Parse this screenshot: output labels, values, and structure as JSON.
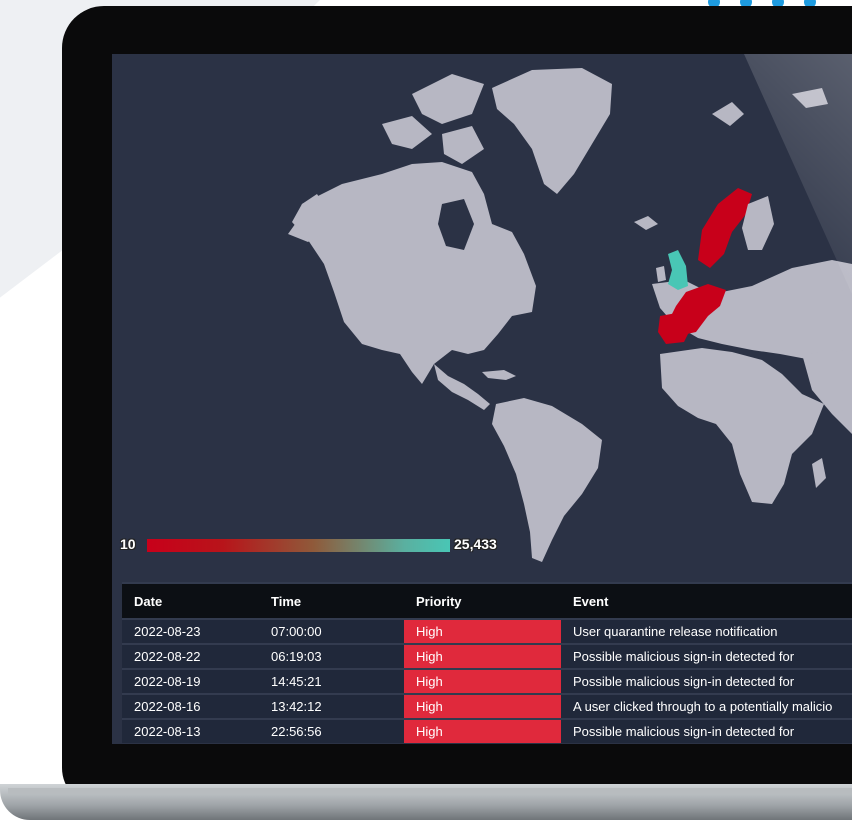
{
  "dashboard": {
    "scale": {
      "min_label": "10",
      "max_label": "25,433"
    },
    "colors": {
      "high_priority": "#e0293c",
      "country_high": "#c8001a",
      "country_low": "#49c6b5",
      "land": "#b7b7c3",
      "ocean": "#2b3245"
    },
    "table": {
      "headers": {
        "date": "Date",
        "time": "Time",
        "priority": "Priority",
        "event": "Event"
      },
      "rows": [
        {
          "date": "2022-08-23",
          "time": "07:00:00",
          "priority": "High",
          "event": "User quarantine release notification"
        },
        {
          "date": "2022-08-22",
          "time": "06:19:03",
          "priority": "High",
          "event": "Possible malicious sign-in detected for"
        },
        {
          "date": "2022-08-19",
          "time": "14:45:21",
          "priority": "High",
          "event": "Possible malicious sign-in detected for"
        },
        {
          "date": "2022-08-16",
          "time": "13:42:12",
          "priority": "High",
          "event": "A user clicked through to a potentially malicio"
        },
        {
          "date": "2022-08-13",
          "time": "22:56:56",
          "priority": "High",
          "event": "Possible malicious sign-in detected for"
        }
      ]
    }
  }
}
